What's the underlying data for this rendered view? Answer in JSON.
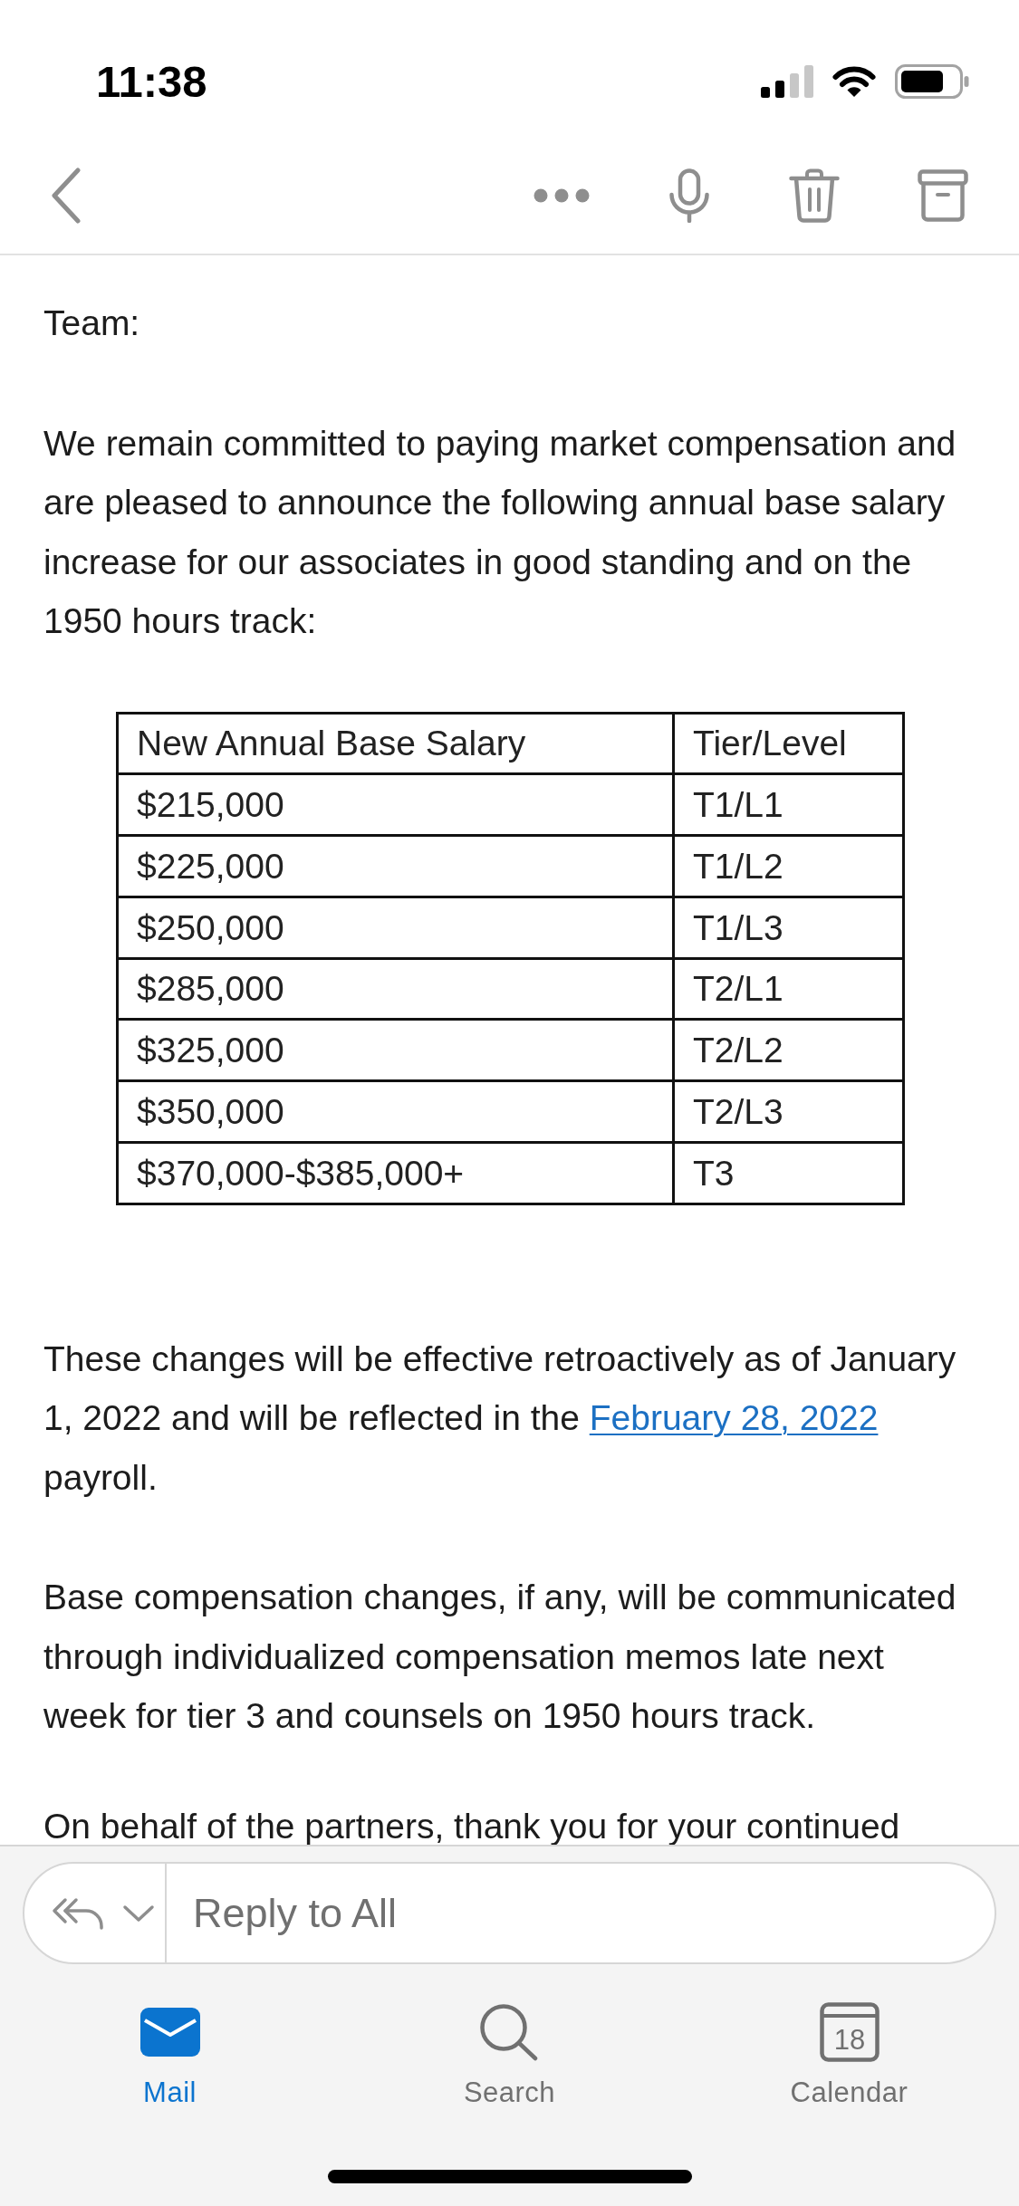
{
  "status_bar": {
    "time": "11:38"
  },
  "email": {
    "body": [
      {
        "kind": "paragraph",
        "text": "Team:"
      },
      {
        "kind": "paragraph",
        "text": "We remain committed to paying market compensation and are pleased to announce the following annual base salary increase for our associates in good standing and on the 1950 hours track:"
      },
      {
        "kind": "table",
        "columns": [
          "New Annual Base Salary",
          "Tier/Level"
        ],
        "rows": [
          [
            "$215,000",
            "T1/L1"
          ],
          [
            "$225,000",
            "T1/L2"
          ],
          [
            "$250,000",
            "T1/L3"
          ],
          [
            "$285,000",
            "T2/L1"
          ],
          [
            "$325,000",
            "T2/L2"
          ],
          [
            "$350,000",
            "T2/L3"
          ],
          [
            "$370,000-$385,000+",
            "T3"
          ]
        ]
      },
      {
        "kind": "paragraph",
        "parts": [
          {
            "kind": "text",
            "text": "These changes will be effective retroactively as of January 1, 2022 and will be reflected in the "
          },
          {
            "kind": "link",
            "text": "February 28, 2022"
          },
          {
            "kind": "text",
            "text": " payroll."
          }
        ]
      },
      {
        "kind": "paragraph",
        "text": "Base compensation changes, if any, will be communicated through individualized compensation memos late next week for tier 3 and counsels on 1950 hours track."
      },
      {
        "kind": "paragraph",
        "text": "On behalf of the partners, thank you for your continued"
      }
    ]
  },
  "reply_bar": {
    "placeholder": "Reply to All"
  },
  "tab_bar": {
    "tabs": [
      {
        "kind": "mail",
        "label": "Mail",
        "selected": true
      },
      {
        "kind": "search",
        "label": "Search",
        "selected": false
      },
      {
        "kind": "calendar",
        "label": "Calendar",
        "selected": false,
        "icon_text": "18"
      }
    ]
  }
}
